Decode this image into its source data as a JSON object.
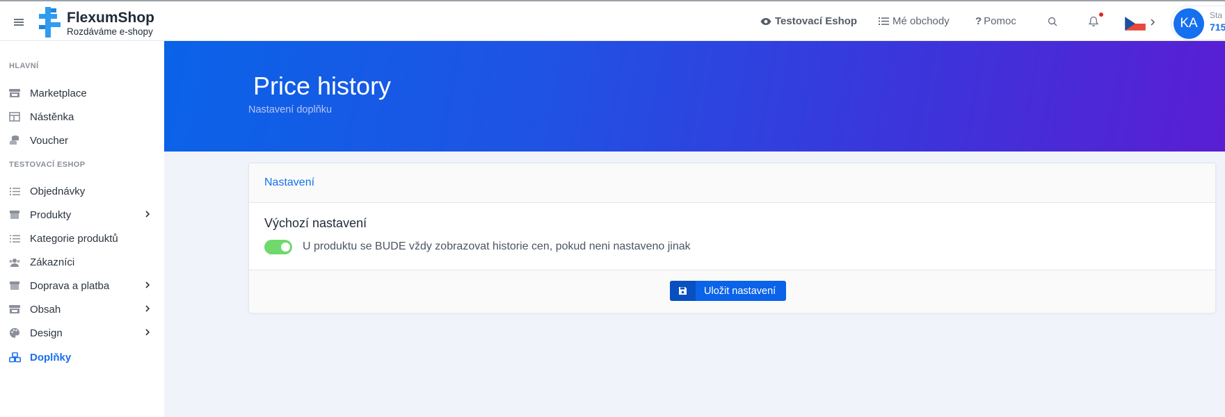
{
  "brand": {
    "name": "FlexumShop",
    "tagline": "Rozdáváme e-shopy"
  },
  "topnav": {
    "eshop": "Testovací Eshop",
    "shops": "Mé obchody",
    "help": "Pomoc"
  },
  "user": {
    "initials": "KA",
    "label": "Sta",
    "value": "715"
  },
  "sidebar": {
    "sections": [
      "HLAVNÍ",
      "TESTOVACÍ ESHOP"
    ],
    "items": [
      {
        "label": "Marketplace",
        "icon": "store-icon"
      },
      {
        "label": "Nástěnka",
        "icon": "dashboard-icon"
      },
      {
        "label": "Voucher",
        "icon": "coins-icon"
      },
      {
        "label": "Objednávky",
        "icon": "list-ordered-icon"
      },
      {
        "label": "Produkty",
        "icon": "box-icon"
      },
      {
        "label": "Kategorie produktů",
        "icon": "list-icon"
      },
      {
        "label": "Zákazníci",
        "icon": "users-icon"
      },
      {
        "label": "Doprava a platba",
        "icon": "box-icon"
      },
      {
        "label": "Obsah",
        "icon": "store-icon"
      },
      {
        "label": "Design",
        "icon": "palette-icon"
      },
      {
        "label": "Doplňky",
        "icon": "cubes-icon",
        "active": true
      }
    ]
  },
  "hero": {
    "title": "Price history",
    "subtitle": "Nastavení doplňku"
  },
  "card": {
    "header": "Nastavení",
    "setting_title": "Výchozí nastavení",
    "setting_desc": "U produktu se BUDE vždy zobrazovat historie cen, pokud neni nastaveno jinak",
    "toggle_on": true,
    "save_label": "Uložit nastavení"
  },
  "colors": {
    "accent": "#1570ef",
    "toggle": "#6fd96b",
    "hero_start": "#0a63e8",
    "hero_end": "#5a1ed3"
  }
}
